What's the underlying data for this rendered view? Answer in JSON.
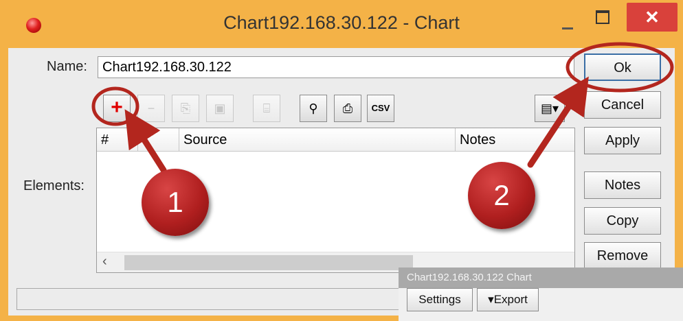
{
  "window": {
    "title": "Chart192.168.30.122 - Chart",
    "close_glyph": "✕"
  },
  "form": {
    "name_label": "Name:",
    "name_value": "Chart192.168.30.122",
    "elements_label": "Elements:"
  },
  "toolbar": {
    "add": "+",
    "remove": "−",
    "copy": "⎘",
    "paste": "▣",
    "comment": "⌸",
    "find": "⚲",
    "print": "⎙",
    "csv": "CSV",
    "columns": "▤▾"
  },
  "table": {
    "columns": [
      "#",
      "Source",
      "Notes"
    ]
  },
  "buttons": {
    "ok": "Ok",
    "cancel": "Cancel",
    "apply": "Apply",
    "notes": "Notes",
    "copy": "Copy",
    "remove": "Remove"
  },
  "annotations": {
    "one": "1",
    "two": "2"
  },
  "chart_window": {
    "title": "Chart192.168.30.122 Chart",
    "settings": "Settings",
    "export": "▾Export"
  },
  "colors": {
    "titlebar": "#f4b247",
    "annotation": "#b3261e",
    "close": "#d9413b"
  }
}
